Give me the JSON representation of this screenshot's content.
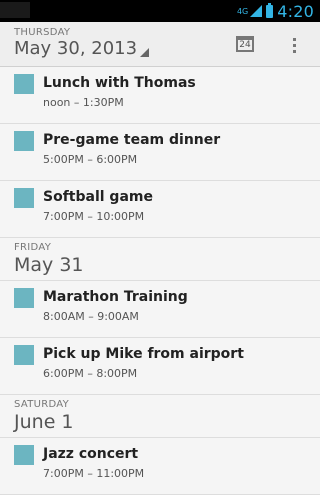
{
  "status_bar": {
    "network": "4G",
    "time": "4:20",
    "accent_color": "#33b5e5"
  },
  "action_bar": {
    "day_label": "THURSDAY",
    "date_label": "May 30, 2013",
    "today_icon_number": "24"
  },
  "colors": {
    "event_swatch": "#6cb5c1"
  },
  "agenda": [
    {
      "type": "event",
      "title": "Lunch with Thomas",
      "time": "noon – 1:30PM"
    },
    {
      "type": "event",
      "title": "Pre-game team dinner",
      "time": "5:00PM – 6:00PM"
    },
    {
      "type": "event",
      "title": "Softball game",
      "time": "7:00PM – 10:00PM"
    },
    {
      "type": "day",
      "day": "FRIDAY",
      "date": "May 31"
    },
    {
      "type": "event",
      "title": "Marathon Training",
      "time": "8:00AM – 9:00AM"
    },
    {
      "type": "event",
      "title": "Pick up Mike from airport",
      "time": "6:00PM – 8:00PM"
    },
    {
      "type": "day",
      "day": "SATURDAY",
      "date": "June 1"
    },
    {
      "type": "event",
      "title": "Jazz concert",
      "time": "7:00PM – 11:00PM"
    }
  ]
}
